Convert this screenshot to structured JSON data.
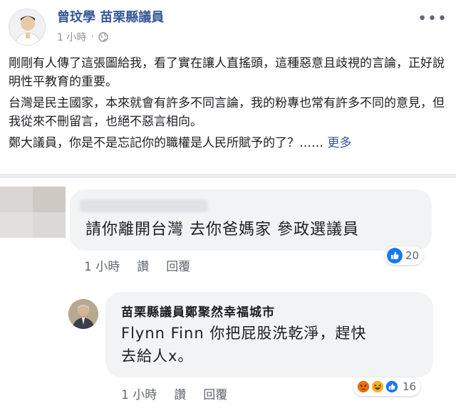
{
  "post": {
    "author": "曾玟學 苗栗縣議員",
    "time": "1 小時",
    "audience_icon": "globe-icon",
    "more_icon": "more-dots-icon",
    "paragraphs": [
      "剛剛有人傳了這張圖給我，看了實在讓人直搖頭，這種惡意且歧視的言論，正好說明性平教育的重要。",
      "台灣是民主國家，本來就會有許多不同言論，我的粉專也常有許多不同的意見，但我從來不刪留言，也絕不惡言相向。",
      "鄭大議員，你是不是忘記你的職權是人民所賦予的了？……"
    ],
    "see_more": "更多"
  },
  "comments": [
    {
      "text": "請你離開台灣 去你爸媽家 參政選議員",
      "time": "1 小時",
      "like": "讚",
      "reply": "回覆",
      "reaction_count": "20",
      "reaction_icons": [
        "like-reaction-icon"
      ]
    },
    {
      "author": "苗栗縣議員鄭聚然幸福城市",
      "text_line1": "Flynn Finn 你把屁股洗乾淨，趕快",
      "text_line2": "去給人x。",
      "time": "1 小時",
      "like": "讚",
      "reply": "回覆",
      "reaction_count": "16",
      "reaction_icons": [
        "angry-reaction-icon",
        "haha-reaction-icon",
        "like-reaction-icon"
      ]
    }
  ],
  "colors": {
    "link": "#365899",
    "bubble": "#f2f3f5",
    "like_blue": "#1877f2",
    "angry": "#e9710f",
    "haha": "#f7b125"
  }
}
